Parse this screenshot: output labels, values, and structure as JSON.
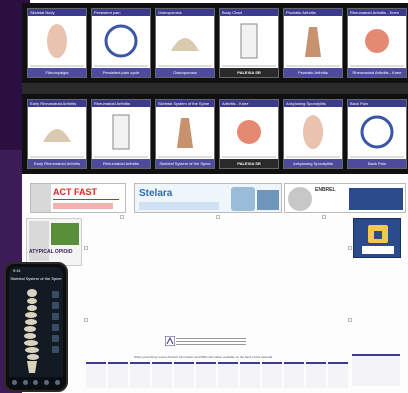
{
  "row1": [
    {
      "title": "Skeletal Body",
      "label": "Fibromyalgia"
    },
    {
      "title": "Persistent pain",
      "label": "Persistent pain cycle"
    },
    {
      "title": "Osteoporosis",
      "label": "Osteoporosis"
    },
    {
      "title": "Body Chart",
      "label": "PALEXIA SR",
      "branded": true
    },
    {
      "title": "Psoriatic Arthritis",
      "label": "Psoriatic Arthritis"
    },
    {
      "title": "Rheumatoid Arthritis - Knee",
      "label": "Rheumatoid Arthritis - Knee"
    }
  ],
  "row2": [
    {
      "title": "Early Rheumatoid Arthritis",
      "label": "Early Rheumatoid Arthritis"
    },
    {
      "title": "Rheumatoid Arthritis",
      "label": "Rheumatoid Arthritis"
    },
    {
      "title": "Skeletal System of the Spine",
      "label": "Skeletal System of the Spine"
    },
    {
      "title": "Arthritis - Knee",
      "label": "PALEXIA SR",
      "branded": true
    },
    {
      "title": "Ankylosing Spondylitis",
      "label": "Ankylosing Spondylitis"
    },
    {
      "title": "Back Pain",
      "label": "Back Pain"
    }
  ],
  "ads": {
    "ad1_headline": "ACT FAST",
    "ad2_brand": "Stelara",
    "ad3_brand": "ENBREL"
  },
  "sidecard_text": "ATYPICAL OPIOID",
  "phone": {
    "status": "9:41",
    "app_title": "Skeletal System of the Spine"
  },
  "bottom_caption": "When prescribing review Product Information and PBS information available on the back of this calendar",
  "colors": {
    "purple": "#3b1c56",
    "poster_header": "#3c3a8f",
    "poster_bar": "#4e4a9e",
    "red": "#e1251b"
  }
}
